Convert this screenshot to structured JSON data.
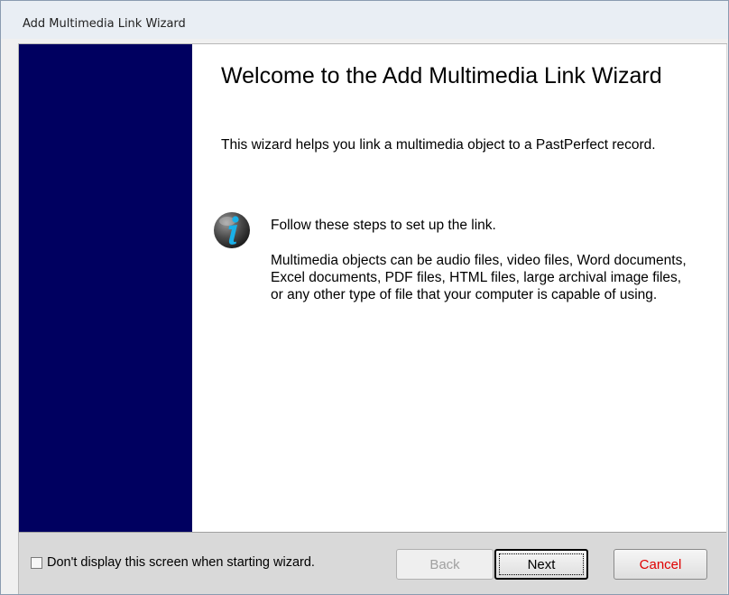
{
  "window": {
    "title": "Add Multimedia Link Wizard"
  },
  "content": {
    "heading": "Welcome to the Add Multimedia Link Wizard",
    "intro": "This wizard helps you link a multimedia object to a PastPerfect record.",
    "step": "Follow these steps to set up the link.",
    "detail": "Multimedia objects can be audio files, video files, Word documents, Excel documents, PDF files, HTML files, large archival image files, or any other type of file that your computer is capable of using.",
    "info_icon": "info-icon"
  },
  "footer": {
    "checkbox_label": "Don't display this screen when starting wizard.",
    "checkbox_checked": false,
    "back_label": "Back",
    "back_enabled": false,
    "next_label": "Next",
    "cancel_label": "Cancel"
  },
  "colors": {
    "side_banner": "#000060",
    "cancel_text": "#e00000",
    "info_icon_accent": "#1ab0e8"
  }
}
